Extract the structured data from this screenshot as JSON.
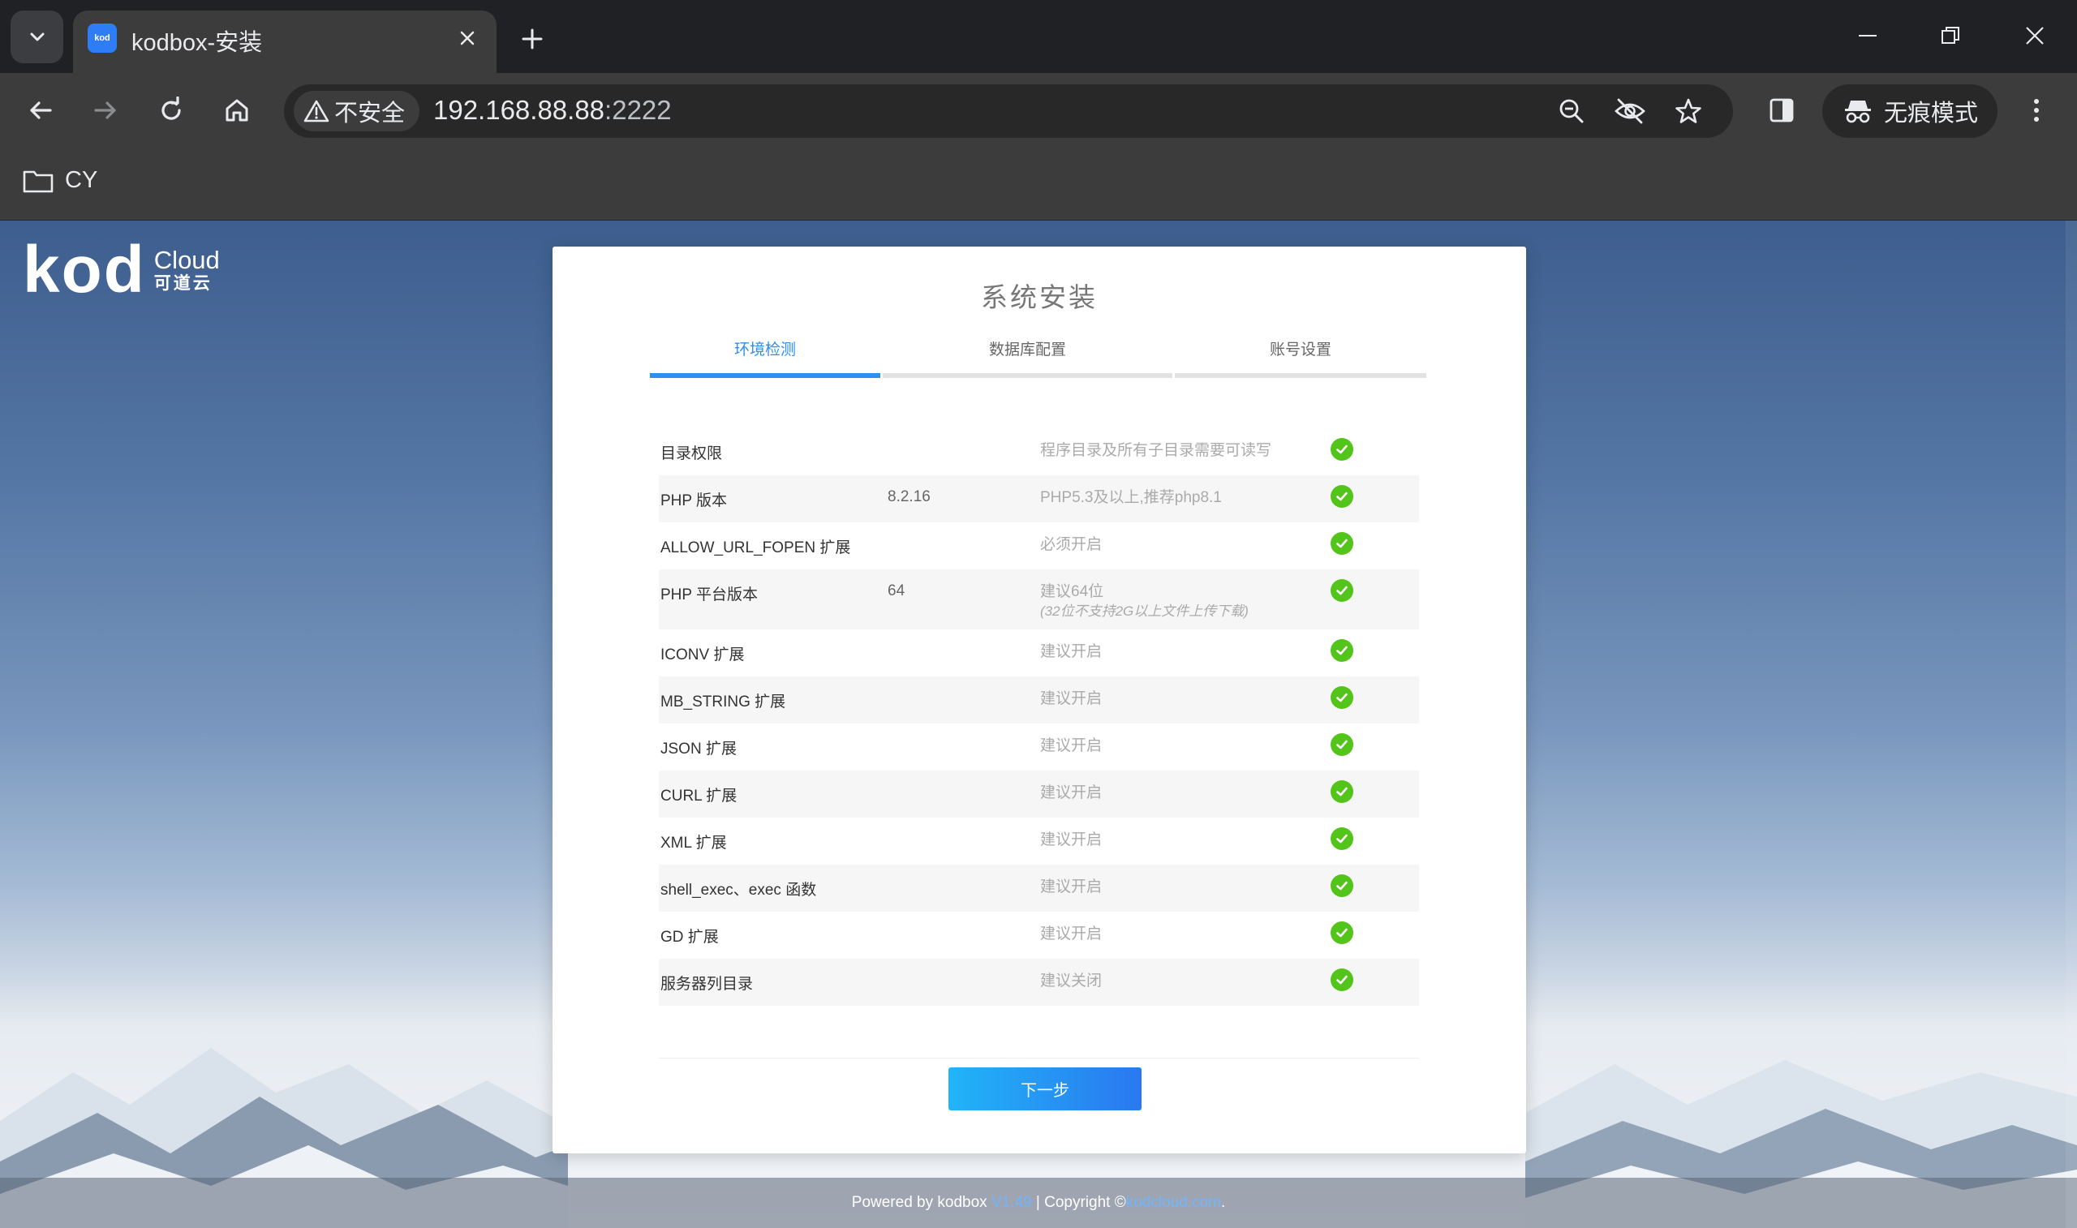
{
  "browser": {
    "tab_title": "kodbox-安装",
    "favicon_text": "kod",
    "security_label": "不安全",
    "url_host": "192.168.88.88",
    "url_port": ":2222",
    "incognito_label": "无痕模式",
    "bookmark_folder": "CY"
  },
  "logo": {
    "mark": "kod",
    "cloud": "Cloud",
    "cn": "可道云"
  },
  "install": {
    "title": "系统安装",
    "steps": [
      {
        "label": "环境检测",
        "active": true
      },
      {
        "label": "数据库配置",
        "active": false
      },
      {
        "label": "账号设置",
        "active": false
      }
    ],
    "checks": [
      {
        "name": "目录权限",
        "value": "",
        "desc": "程序目录及所有子目录需要可读写",
        "note": "",
        "status": "ok"
      },
      {
        "name": "PHP 版本",
        "value": "8.2.16",
        "desc": "PHP5.3及以上,推荐php8.1",
        "note": "",
        "status": "ok"
      },
      {
        "name": "ALLOW_URL_FOPEN 扩展",
        "value": "",
        "desc": "必须开启",
        "note": "",
        "status": "ok"
      },
      {
        "name": "PHP 平台版本",
        "value": "64",
        "desc": "建议64位",
        "note": "(32位不支持2G以上文件上传下载)",
        "status": "ok"
      },
      {
        "name": "ICONV 扩展",
        "value": "",
        "desc": "建议开启",
        "note": "",
        "status": "ok"
      },
      {
        "name": "MB_STRING 扩展",
        "value": "",
        "desc": "建议开启",
        "note": "",
        "status": "ok"
      },
      {
        "name": "JSON 扩展",
        "value": "",
        "desc": "建议开启",
        "note": "",
        "status": "ok"
      },
      {
        "name": "CURL 扩展",
        "value": "",
        "desc": "建议开启",
        "note": "",
        "status": "ok"
      },
      {
        "name": "XML 扩展",
        "value": "",
        "desc": "建议开启",
        "note": "",
        "status": "ok"
      },
      {
        "name": "shell_exec、exec 函数",
        "value": "",
        "desc": "建议开启",
        "note": "",
        "status": "ok"
      },
      {
        "name": "GD 扩展",
        "value": "",
        "desc": "建议开启",
        "note": "",
        "status": "ok"
      },
      {
        "name": "服务器列目录",
        "value": "",
        "desc": "建议关闭",
        "note": "",
        "status": "ok"
      }
    ],
    "next_button": "下一步"
  },
  "footer": {
    "powered": "Powered by kodbox",
    "version": "V1.49",
    "separator": "|",
    "copyright": "Copyright ©",
    "site": "kodcloud.com",
    "tail": "."
  },
  "colors": {
    "accent": "#2c8ff2",
    "ok_green": "#52c41a",
    "chrome_dark": "#202124",
    "chrome_toolbar": "#3c3c3c"
  }
}
